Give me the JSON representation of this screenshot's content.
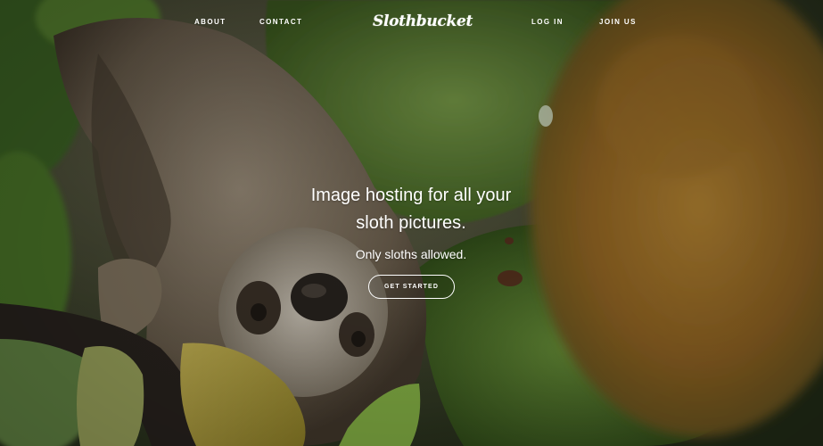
{
  "nav": {
    "left_links": [
      {
        "label": "ABOUT"
      },
      {
        "label": "CONTACT"
      }
    ],
    "brand": "Slothbucket",
    "right_links": [
      {
        "label": "LOG IN"
      },
      {
        "label": "JOIN US"
      }
    ]
  },
  "hero": {
    "headline_line1": "Image hosting for all your",
    "headline_line2": "sloth pictures.",
    "subheadline": "Only sloths allowed.",
    "cta_label": "GET STARTED",
    "background_image": "sloth-hanging-among-leaves-photo"
  },
  "colors": {
    "text": "#ffffff",
    "leaf_green": "#7fa84a",
    "dark_foliage": "#2b3a22",
    "sloth_fur": "#8a7a66",
    "blurred_leaf": "#b9862f"
  }
}
